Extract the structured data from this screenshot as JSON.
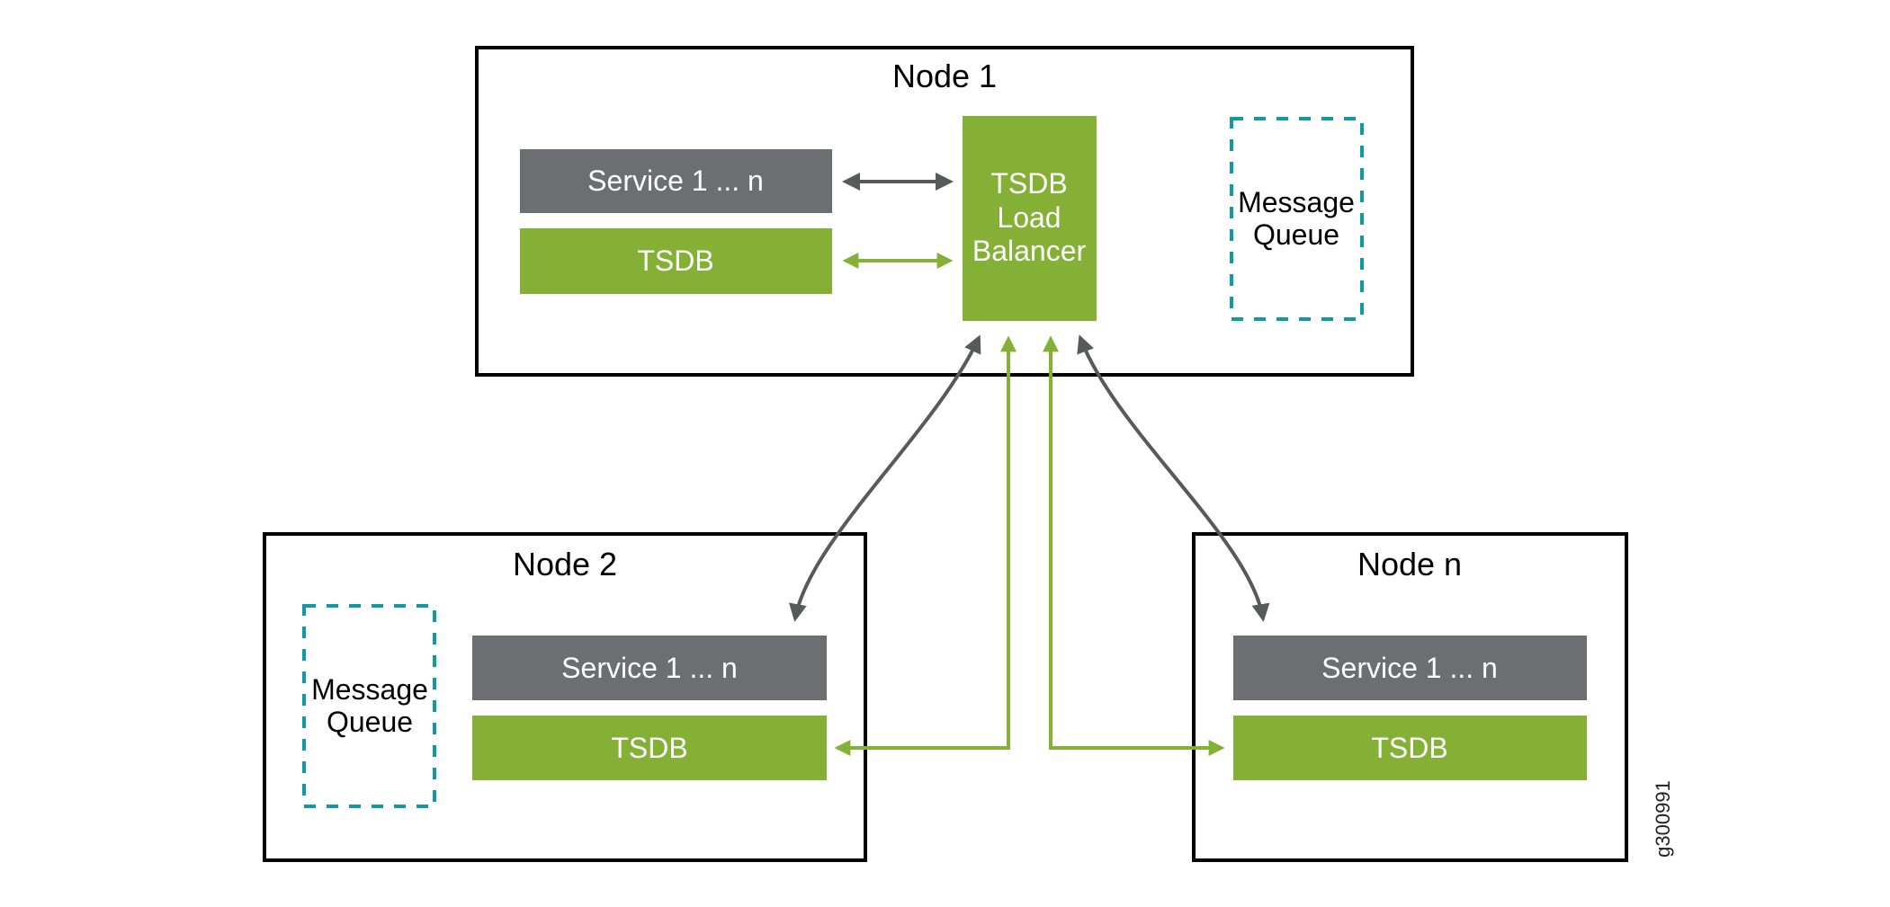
{
  "colors": {
    "service": "#6d6e71",
    "tsdb": "#84b135",
    "queue_dash": "#1199a6",
    "gray_arrow": "#58595b",
    "green_arrow": "#84b135",
    "border": "#000000"
  },
  "nodes": [
    {
      "title": "Node 1",
      "service_label": "Service 1 ... n",
      "tsdb_label": "TSDB",
      "load_balancer_lines": [
        "TSDB",
        "Load",
        "Balancer"
      ],
      "queue_lines": [
        "Message",
        "Queue"
      ]
    },
    {
      "title": "Node 2",
      "service_label": "Service 1 ... n",
      "tsdb_label": "TSDB",
      "queue_lines": [
        "Message",
        "Queue"
      ]
    },
    {
      "title": "Node n",
      "service_label": "Service 1 ... n",
      "tsdb_label": "TSDB"
    }
  ],
  "connections": [
    {
      "from": "Node 1 Service 1 ... n",
      "to": "TSDB Load Balancer",
      "style": "gray",
      "direction": "bidirectional"
    },
    {
      "from": "Node 1 TSDB",
      "to": "TSDB Load Balancer",
      "style": "green",
      "direction": "bidirectional"
    },
    {
      "from": "Node 2 Service 1 ... n",
      "to": "TSDB Load Balancer",
      "style": "gray",
      "direction": "bidirectional"
    },
    {
      "from": "Node n Service 1 ... n",
      "to": "TSDB Load Balancer",
      "style": "gray",
      "direction": "bidirectional"
    },
    {
      "from": "Node 2 TSDB",
      "to": "TSDB Load Balancer",
      "style": "green",
      "direction": "bidirectional"
    },
    {
      "from": "Node n TSDB",
      "to": "TSDB Load Balancer",
      "style": "green",
      "direction": "bidirectional"
    }
  ],
  "figure_id": "g300991"
}
